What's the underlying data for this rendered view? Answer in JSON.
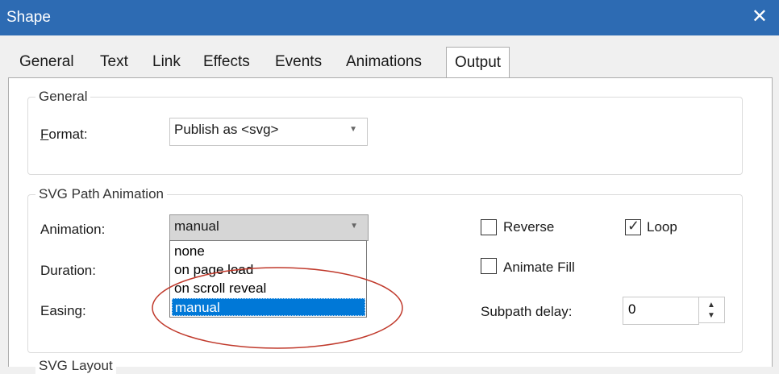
{
  "window": {
    "title": "Shape",
    "close_glyph": "✕"
  },
  "tabs": [
    {
      "label": "General"
    },
    {
      "label": "Text"
    },
    {
      "label": "Link"
    },
    {
      "label": "Effects"
    },
    {
      "label": "Events"
    },
    {
      "label": "Animations"
    },
    {
      "label": "Output"
    }
  ],
  "active_tab": "Output",
  "general_group": {
    "legend": "General",
    "format_label": "Format:",
    "format_label_accel": "F",
    "format_label_rest": "ormat:",
    "format_value": "Publish as <svg>"
  },
  "svg_anim_group": {
    "legend": "SVG Path Animation",
    "animation_label": "Animation:",
    "animation_value": "manual",
    "duration_label": "Duration:",
    "easing_label": "Easing:",
    "animation_options": [
      "none",
      "on page load",
      "on scroll reveal",
      "manual"
    ],
    "selected_option": "manual",
    "reverse_label": "Reverse",
    "reverse_checked": false,
    "loop_label": "Loop",
    "loop_checked": true,
    "animate_fill_label": "Animate Fill",
    "animate_fill_checked": false,
    "subpath_delay_label": "Subpath delay:",
    "subpath_delay_value": "0"
  },
  "svg_layout_group": {
    "legend": "SVG Layout"
  },
  "icons": {
    "close": "close-icon",
    "dropdown": "chevron-down-icon",
    "spin_up": "arrow-up-icon",
    "spin_down": "arrow-down-icon",
    "check": "checkmark-icon"
  },
  "colors": {
    "titlebar": "#2d6bb3",
    "selection": "#0078d7",
    "annotation": "#c0392b"
  }
}
